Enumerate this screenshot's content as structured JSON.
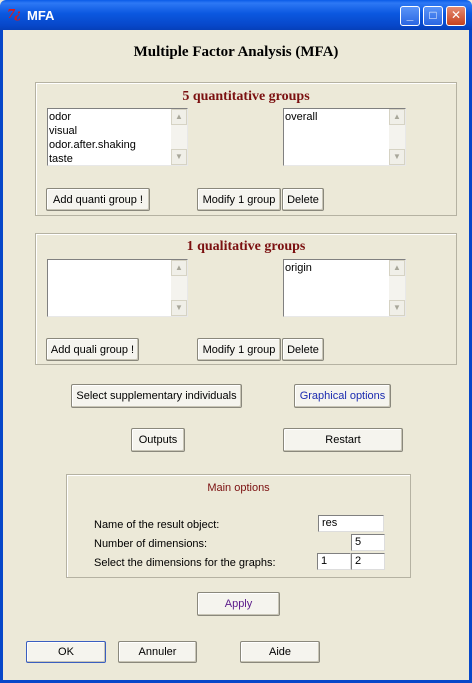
{
  "window": {
    "icon_text": "7¿",
    "title": "MFA",
    "minimize": "_",
    "maximize": "□",
    "close": "✕"
  },
  "heading": "Multiple Factor Analysis (MFA)",
  "quantitative": {
    "title": "5 quantitative groups",
    "variables": [
      "odor",
      "visual",
      "odor.after.shaking",
      "taste"
    ],
    "groups": [
      "overall"
    ],
    "add_label": "Add quanti group !",
    "modify_label": "Modify 1 group",
    "delete_label": "Delete"
  },
  "qualitative": {
    "title": "1 qualitative groups",
    "variables": [],
    "groups": [
      "origin"
    ],
    "add_label": "Add quali group !",
    "modify_label": "Modify 1 group",
    "delete_label": "Delete"
  },
  "actions": {
    "supplementary_label": "Select supplementary individuals",
    "graphical_label": "Graphical options",
    "outputs_label": "Outputs",
    "restart_label": "Restart"
  },
  "main_options": {
    "title": "Main options",
    "result_name_label": "Name of the result object:",
    "result_name_value": "res",
    "ndim_label": "Number of dimensions:",
    "ndim_value": "5",
    "dims_label": "Select the dimensions for the graphs:",
    "dim1_value": "1",
    "dim2_value": "2"
  },
  "apply_label": "Apply",
  "footer": {
    "ok_label": "OK",
    "cancel_label": "Annuler",
    "help_label": "Aide"
  },
  "colors": {
    "titlebar": "#0b58e0",
    "group_title": "#7b1010",
    "graphical_button_text": "#1b2bb0",
    "apply_text": "#5a1a8a",
    "window_bg": "#ece9d8"
  }
}
